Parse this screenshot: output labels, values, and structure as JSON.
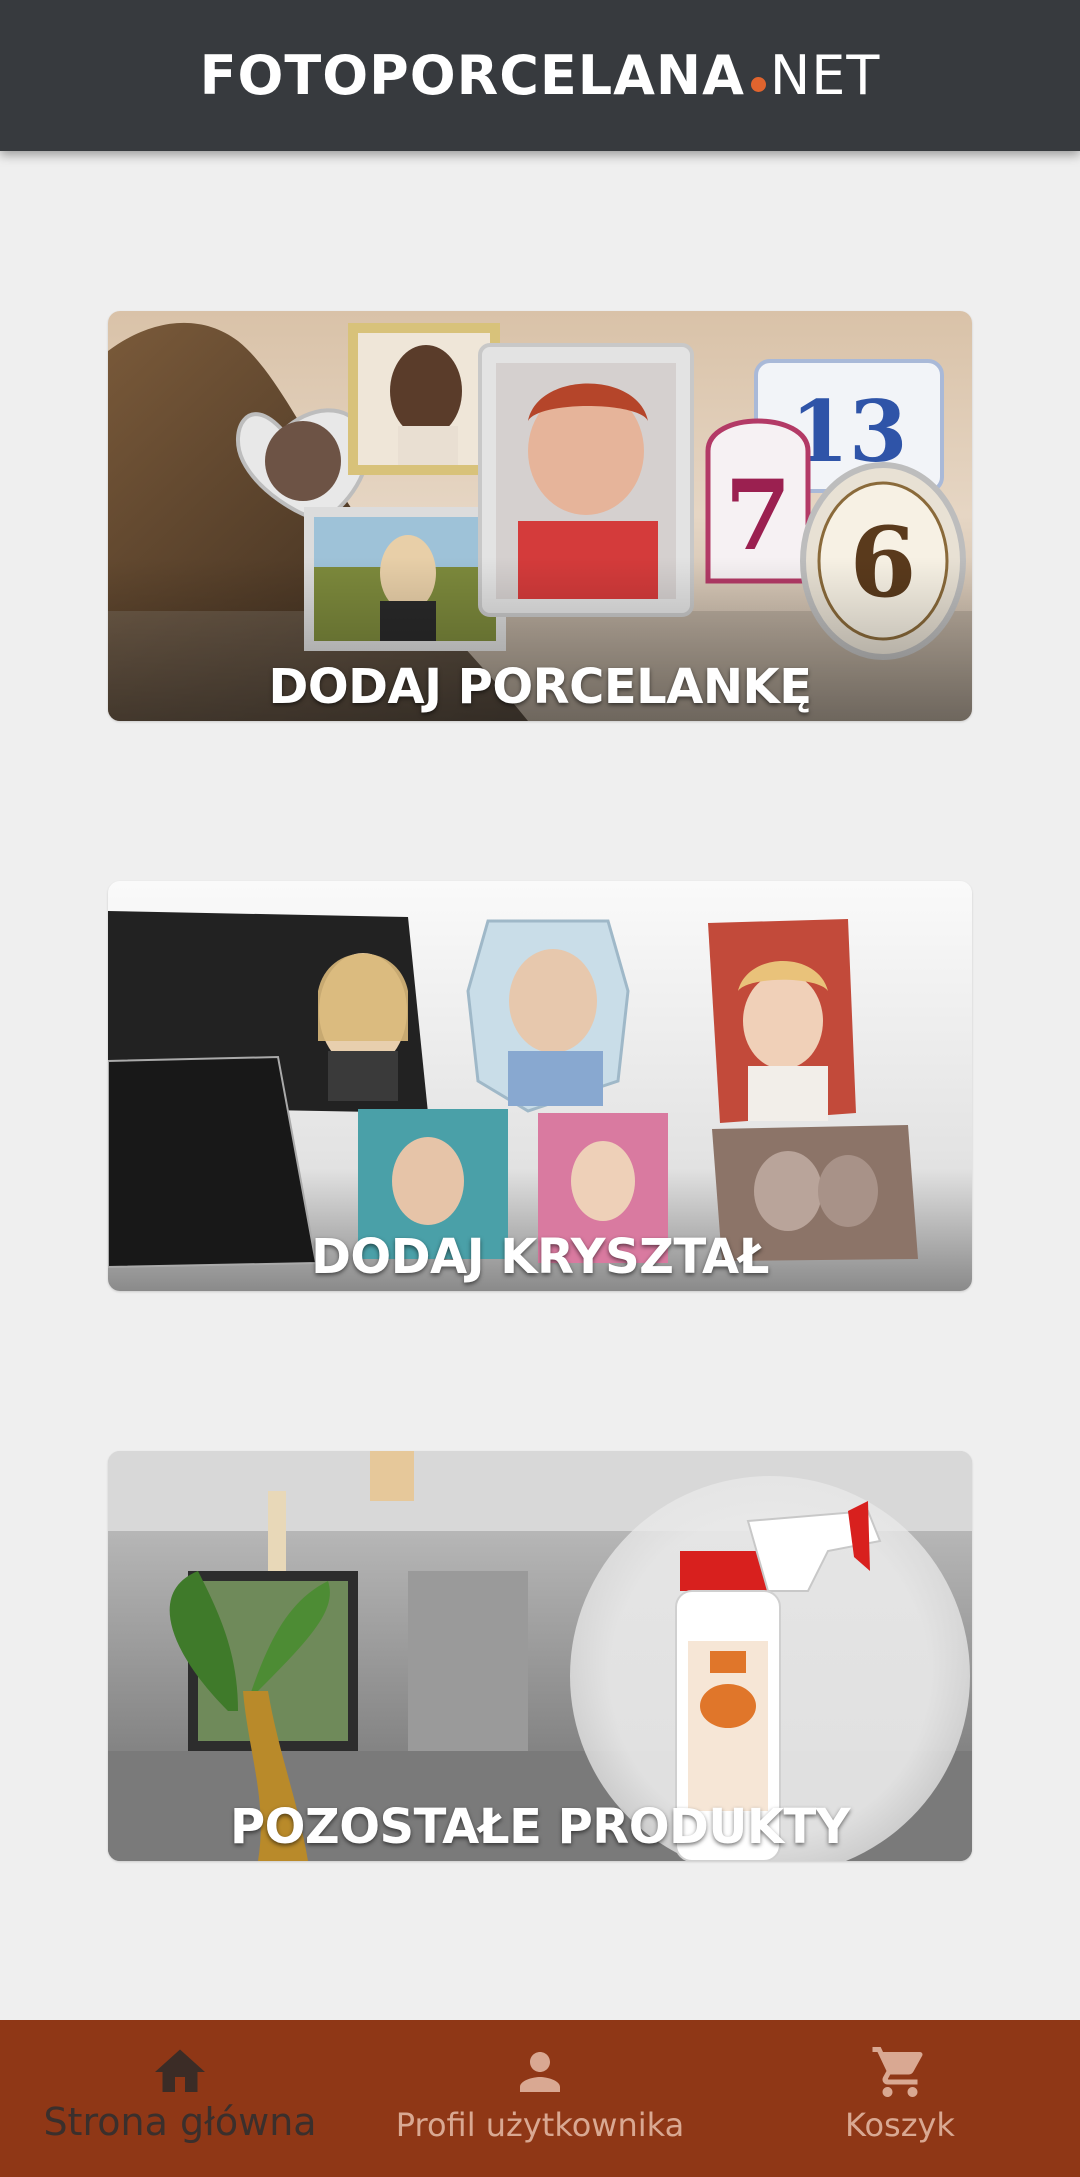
{
  "header": {
    "logo_bold": "FOTOPORCELANA",
    "logo_suffix": "NET",
    "logo_dot_color": "#e0642e",
    "background_color": "#373a3e"
  },
  "cards": [
    {
      "label": "DODAJ PORCELANKĘ",
      "icon": "porcelain-photo-plaques-image"
    },
    {
      "label": "DODAJ KRYSZTAŁ",
      "icon": "crystal-photo-blocks-image"
    },
    {
      "label": "POZOSTAŁE PRODUKTY",
      "icon": "cleaning-products-image"
    }
  ],
  "nav": {
    "background_color": "#8f3716",
    "items": [
      {
        "label": "Strona główna",
        "icon": "home-icon",
        "active": true
      },
      {
        "label": "Profil użytkownika",
        "icon": "person-icon",
        "active": false
      },
      {
        "label": "Koszyk",
        "icon": "cart-icon",
        "active": false
      }
    ]
  }
}
